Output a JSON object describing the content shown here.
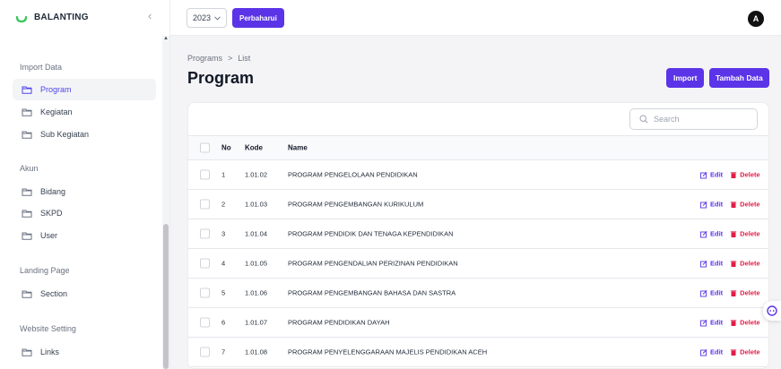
{
  "brand": {
    "name": "BALANTING"
  },
  "topbar": {
    "year": "2023",
    "refresh_label": "Perbaharui",
    "avatar_initial": "A"
  },
  "sidebar": {
    "sections": [
      {
        "title": "Import Data",
        "items": [
          {
            "label": "Program",
            "icon": "folder-icon",
            "active": true
          },
          {
            "label": "Kegiatan",
            "icon": "folder-icon"
          },
          {
            "label": "Sub Kegiatan",
            "icon": "folder-icon"
          }
        ]
      },
      {
        "title": "Akun",
        "items": [
          {
            "label": "Bidang",
            "icon": "folder-icon"
          },
          {
            "label": "SKPD",
            "icon": "folder-icon"
          },
          {
            "label": "User",
            "icon": "folder-icon"
          }
        ]
      },
      {
        "title": "Landing Page",
        "items": [
          {
            "label": "Section",
            "icon": "folder-icon"
          }
        ]
      },
      {
        "title": "Website Setting",
        "items": [
          {
            "label": "Links",
            "icon": "folder-icon"
          }
        ]
      }
    ]
  },
  "breadcrumb": {
    "root": "Programs",
    "separator": ">",
    "current": "List"
  },
  "page": {
    "title": "Program",
    "import_label": "Import",
    "add_label": "Tambah Data"
  },
  "search": {
    "placeholder": "Search"
  },
  "table": {
    "headers": {
      "no": "No",
      "kode": "Kode",
      "name": "Name"
    },
    "edit_label": "Edit",
    "delete_label": "Delete",
    "rows": [
      {
        "no": "1",
        "kode": "1.01.02",
        "name": "PROGRAM PENGELOLAAN PENDIDIKAN"
      },
      {
        "no": "2",
        "kode": "1.01.03",
        "name": "PROGRAM PENGEMBANGAN KURIKULUM"
      },
      {
        "no": "3",
        "kode": "1.01.04",
        "name": "PROGRAM PENDIDIK DAN TENAGA KEPENDIDIKAN"
      },
      {
        "no": "4",
        "kode": "1.01.05",
        "name": "PROGRAM PENGENDALIAN PERIZINAN PENDIDIKAN"
      },
      {
        "no": "5",
        "kode": "1.01.06",
        "name": "PROGRAM PENGEMBANGAN BAHASA DAN SASTRA"
      },
      {
        "no": "6",
        "kode": "1.01.07",
        "name": "PROGRAM PENDIDIKAN DAYAH"
      },
      {
        "no": "7",
        "kode": "1.01.08",
        "name": "PROGRAM PENYELENGGARAAN MAJELIS PENDIDIKAN ACEH"
      }
    ]
  },
  "colors": {
    "accent": "#5b34e8",
    "danger": "#e11d48",
    "brand_logo": "#34c759"
  }
}
